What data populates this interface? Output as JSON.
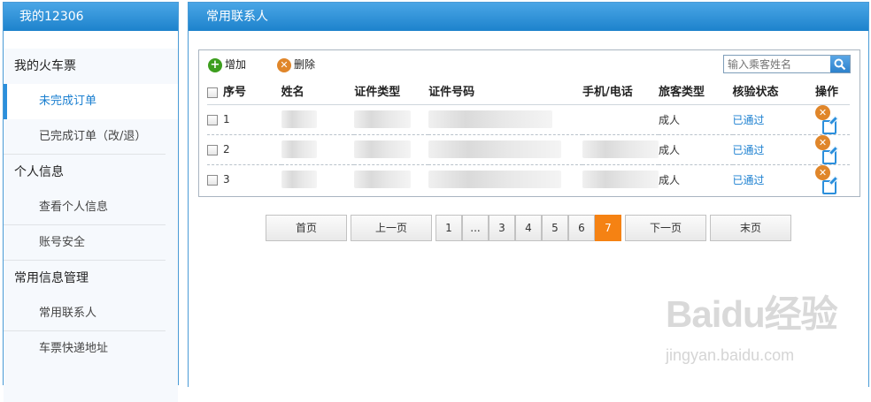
{
  "sidebar": {
    "title": "我的12306",
    "groups": [
      {
        "label": "我的火车票",
        "items": [
          {
            "label": "未完成订单",
            "active": true
          },
          {
            "label": "已完成订单（改/退）"
          }
        ]
      },
      {
        "label": "个人信息",
        "items": [
          {
            "label": "查看个人信息"
          },
          {
            "label": "账号安全"
          }
        ]
      },
      {
        "label": "常用信息管理",
        "items": [
          {
            "label": "常用联系人"
          },
          {
            "label": "车票快递地址"
          }
        ]
      }
    ]
  },
  "main": {
    "title": "常用联系人",
    "toolbar": {
      "add_label": "增加",
      "delete_label": "删除"
    },
    "search": {
      "placeholder": "输入乘客姓名"
    },
    "table": {
      "columns": [
        "序号",
        "姓名",
        "证件类型",
        "证件号码",
        "手机/电话",
        "旅客类型",
        "核验状态",
        "操作"
      ],
      "rows": [
        {
          "index": "1",
          "passenger_type": "成人",
          "status": "已通过"
        },
        {
          "index": "2",
          "passenger_type": "成人",
          "status": "已通过"
        },
        {
          "index": "3",
          "passenger_type": "成人",
          "status": "已通过"
        }
      ]
    },
    "pagination": {
      "first": "首页",
      "prev": "上一页",
      "pages": [
        "1",
        "...",
        "3",
        "4",
        "5",
        "6",
        "7"
      ],
      "current": "7",
      "next": "下一页",
      "last": "末页"
    }
  },
  "watermark": {
    "logo": "Baidu经验",
    "url": "jingyan.baidu.com"
  },
  "colors": {
    "header_blue": "#1d82cc",
    "link_blue": "#1a7fd0",
    "current_page": "#f58213",
    "add_green": "#3d9e1e",
    "delete_orange": "#e0862a"
  }
}
